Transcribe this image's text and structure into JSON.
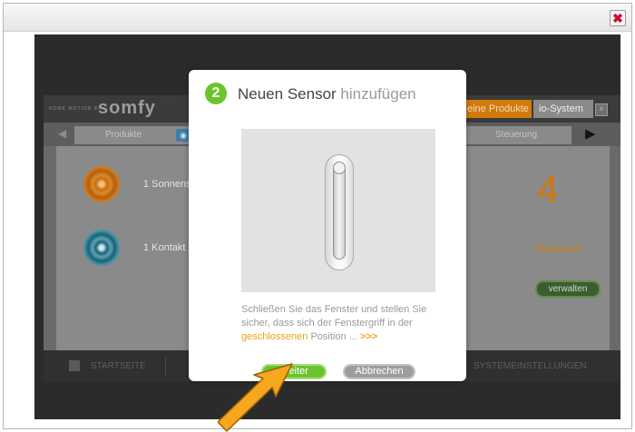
{
  "window": {
    "close_glyph": "✖",
    "close_color": "#c8102e"
  },
  "app": {
    "brand_tagline": "HOME MOTION BY",
    "brand_logo": "somfy",
    "header_tabs": {
      "products": "eine Produkte",
      "io_system": "io-System"
    },
    "nav": {
      "prev_arrow": "◀",
      "next_arrow": "▶",
      "tab_produkte": "Produkte",
      "tab_steuerung": "Steuerung"
    },
    "sensors": [
      {
        "label": "1 Sonnens",
        "icon": "sun-sensor-icon",
        "color": "#c76e0f"
      },
      {
        "label": "1 Kontakt",
        "icon": "contact-sensor-icon",
        "color": "#1b6277"
      }
    ],
    "sensor_count": "4",
    "sensor_count_label": "Sensoren",
    "manage_button": "verwalten",
    "bottom_left": "STARTSEITE",
    "bottom_right": "SYSTEMEINSTELLUNGEN"
  },
  "modal": {
    "step": "2",
    "title_a": "Neuen Sensor",
    "title_b": "hinzufügen",
    "image": "window-handle-closed",
    "text_1": "Schließen Sie das Fenster und stellen Sie sicher, dass sich der Fenstergriff in der",
    "text_highlight": "geschlossenen",
    "text_2": "Position",
    "text_dots": "...",
    "text_more": ">>>",
    "next_button": "Weiter",
    "cancel_button": "Abbrechen"
  },
  "colors": {
    "accent_green": "#6cc42c",
    "accent_orange": "#f0a010",
    "somfy_orange": "#d17b0c"
  }
}
